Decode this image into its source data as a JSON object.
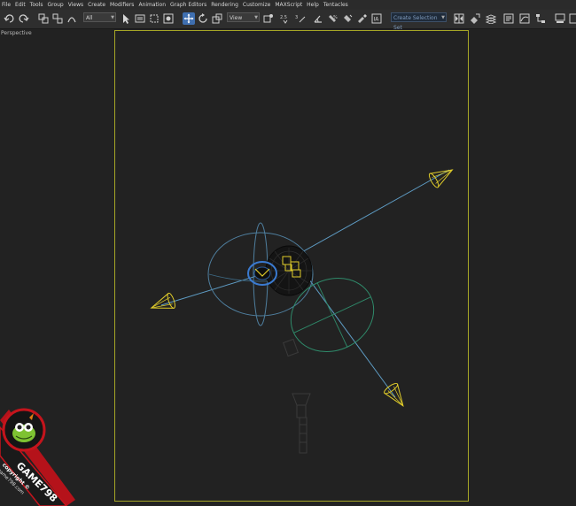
{
  "menu": [
    "File",
    "Edit",
    "Tools",
    "Group",
    "Views",
    "Create",
    "Modifiers",
    "Animation",
    "Graph Editors",
    "Rendering",
    "Customize",
    "MAXScript",
    "Help",
    "Tentacles"
  ],
  "toolbar": {
    "selection_filter": "All",
    "reference_coord": "View",
    "named_selection_placeholder": "Create Selection Set"
  },
  "viewport": {
    "label": "Perspective"
  },
  "watermark": {
    "brand": "GAME798",
    "copyright": "copyright ©",
    "url": "game798.com"
  },
  "colors": {
    "safe_frame": "#a6a626",
    "light_cone": "#e0cc2a",
    "light_line": "#5e9cc4",
    "gizmo_blue": "#4f7f9f",
    "gizmo_green": "#2f8a6a",
    "selection_blue": "#3a7ad0",
    "logo_red": "#c4141c"
  }
}
